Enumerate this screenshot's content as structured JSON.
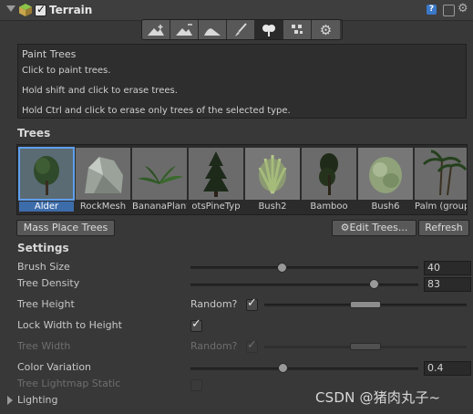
{
  "header": {
    "title": "Terrain",
    "enabled": true,
    "icons": [
      "terrain-cube-icon",
      "help-book-icon",
      "preset-icon",
      "gear-icon"
    ]
  },
  "toolbar": {
    "tools": [
      {
        "name": "raise-lower-terrain",
        "icon": "raise-terrain-icon",
        "active": false
      },
      {
        "name": "paint-height",
        "icon": "paint-height-icon",
        "active": false
      },
      {
        "name": "smooth-height",
        "icon": "smooth-height-icon",
        "active": false
      },
      {
        "name": "paint-texture",
        "icon": "paint-brush-icon",
        "active": false
      },
      {
        "name": "place-trees",
        "icon": "tree-icon",
        "active": true
      },
      {
        "name": "paint-details",
        "icon": "grass-icon",
        "active": false
      },
      {
        "name": "terrain-settings",
        "icon": "gear-icon",
        "active": false
      }
    ]
  },
  "help": {
    "title": "Paint Trees",
    "line1": "Click to paint trees.",
    "line2": "Hold shift and click to erase trees.",
    "line3": "Hold Ctrl and click to erase only trees of the selected type."
  },
  "trees": {
    "heading": "Trees",
    "items": [
      {
        "label": "Alder",
        "selected": true
      },
      {
        "label": "RockMesh",
        "selected": false
      },
      {
        "label": "BananaPlant",
        "selected": false
      },
      {
        "label": "otsPineTyp",
        "selected": false
      },
      {
        "label": "Bush2",
        "selected": false
      },
      {
        "label": "Bamboo",
        "selected": false
      },
      {
        "label": "Bush6",
        "selected": false
      },
      {
        "label": "Palm (group",
        "selected": false
      }
    ]
  },
  "buttons": {
    "mass_place": "Mass Place Trees",
    "edit_trees": "Edit Trees...",
    "refresh": "Refresh"
  },
  "settings": {
    "heading": "Settings",
    "brush_size": {
      "label": "Brush Size",
      "value": "40",
      "fraction": 0.39
    },
    "tree_density": {
      "label": "Tree Density",
      "value": "83",
      "fraction": 0.83
    },
    "tree_height": {
      "label": "Tree Height",
      "random_label": "Random?",
      "random": true
    },
    "lock_width": {
      "label": "Lock Width to Height",
      "checked": true
    },
    "tree_width": {
      "label": "Tree Width",
      "random_label": "Random?",
      "random": true,
      "disabled": true
    },
    "color_variation": {
      "label": "Color Variation",
      "value": "0.4",
      "fraction": 0.4
    },
    "lightmap_static": {
      "label": "Tree Lightmap Static",
      "checked": false,
      "disabled": true
    }
  },
  "lighting": {
    "label": "Lighting"
  },
  "watermark": "CSDN @猪肉丸子~"
}
